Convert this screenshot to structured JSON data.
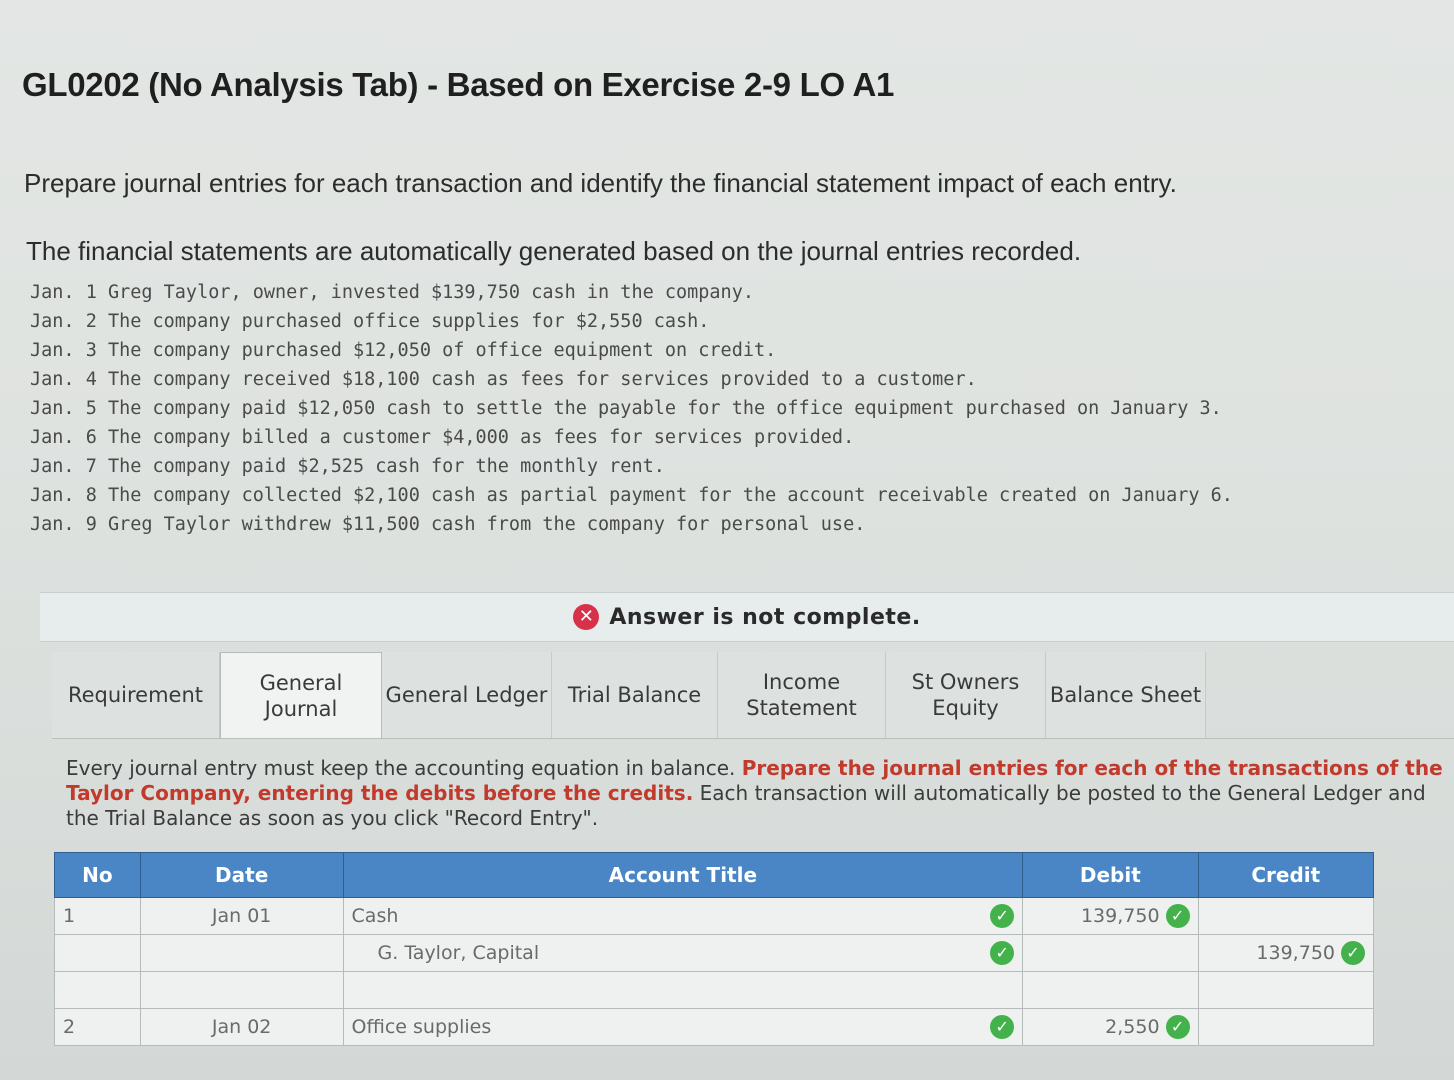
{
  "title": "GL0202 (No Analysis Tab) - Based on Exercise 2-9 LO A1",
  "intro_line1": "Prepare journal entries for each transaction and identify the financial statement impact of each entry.",
  "intro_line2": "The financial statements are automatically generated based on the journal entries recorded.",
  "transactions": [
    "Jan. 1 Greg Taylor, owner, invested $139,750 cash in the company.",
    "Jan. 2 The company purchased office supplies for $2,550 cash.",
    "Jan. 3 The company purchased $12,050 of office equipment on credit.",
    "Jan. 4 The company received $18,100 cash as fees for services provided to a customer.",
    "Jan. 5 The company paid $12,050 cash to settle the payable for the office equipment purchased on January 3.",
    "Jan. 6 The company billed a customer $4,000 as fees for services provided.",
    "Jan. 7 The company paid $2,525 cash for the monthly rent.",
    "Jan. 8 The company collected $2,100 cash as partial payment for the account receivable created on January 6.",
    "Jan. 9 Greg Taylor withdrew $11,500 cash from the company for personal use."
  ],
  "answer_status": "Answer is not complete.",
  "tabs": [
    {
      "label": "Requirement"
    },
    {
      "label": "General Journal"
    },
    {
      "label": "General Ledger"
    },
    {
      "label": "Trial Balance"
    },
    {
      "label": "Income Statement"
    },
    {
      "label": "St Owners Equity"
    },
    {
      "label": "Balance Sheet"
    }
  ],
  "instructions": {
    "part1": "Every journal entry must keep the accounting equation in balance.",
    "part2": "Prepare the journal entries for each of the transactions of the Taylor Company, entering the debits before the credits.",
    "part3": "Each transaction will automatically be posted to the General Ledger and the Trial Balance as soon as you click \"Record Entry\"."
  },
  "journal": {
    "headers": {
      "no": "No",
      "date": "Date",
      "account": "Account Title",
      "debit": "Debit",
      "credit": "Credit"
    },
    "rows": [
      {
        "no": "1",
        "date": "Jan 01",
        "account": "Cash",
        "debit": "139,750",
        "credit": ""
      },
      {
        "no": "",
        "date": "",
        "account": "G. Taylor, Capital",
        "debit": "",
        "credit": "139,750"
      },
      {
        "no": "",
        "date": "",
        "account": "",
        "debit": "",
        "credit": ""
      },
      {
        "no": "2",
        "date": "Jan 02",
        "account": "Office supplies",
        "debit": "2,550",
        "credit": ""
      }
    ]
  },
  "colors": {
    "header_blue": "#4a86c5",
    "error_red": "#d6324a",
    "check_green": "#43b24b",
    "emphasis_red": "#c23a2c"
  }
}
